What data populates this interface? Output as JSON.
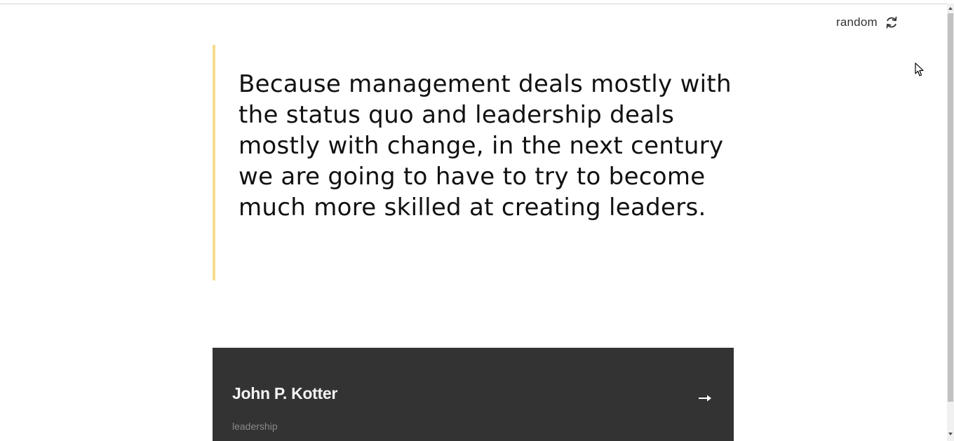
{
  "header": {
    "random_label": "random",
    "random_icon": "refresh-icon"
  },
  "quote": {
    "text": "Because management deals mostly with the status quo and leadership deals mostly with change, in the next century we are going to have to try to become much more skilled at creating leaders.",
    "accent_color": "#f6dc8c"
  },
  "author_card": {
    "author": "John P. Kotter",
    "genre": "leadership",
    "arrow_icon": "arrow-right-icon",
    "background_color": "#333333"
  }
}
